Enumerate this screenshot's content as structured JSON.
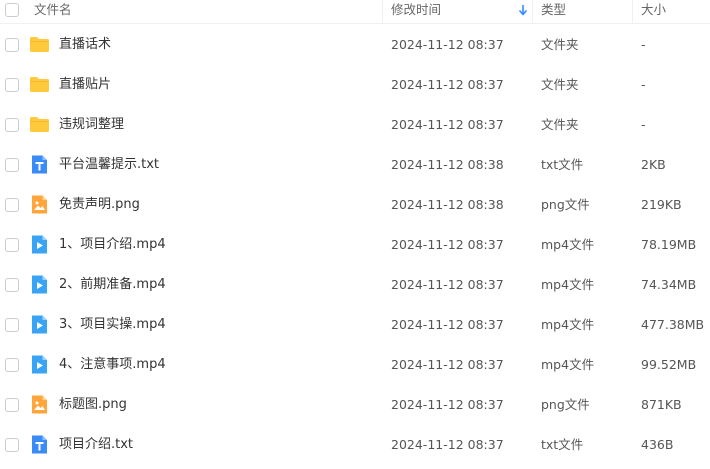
{
  "header": {
    "name_label": "文件名",
    "time_label": "修改时间",
    "type_label": "类型",
    "size_label": "大小",
    "sort_icon": "arrow-down-icon",
    "sort_color": "#2f8cff"
  },
  "colors": {
    "folder": "#ffc93c",
    "text_icon": "#3a8bf5",
    "image_icon": "#ffa53a",
    "video_icon": "#39a3f5"
  },
  "files": [
    {
      "icon": "folder-icon",
      "name": "直播话术",
      "time": "2024-11-12 08:37",
      "type": "文件夹",
      "size": "-"
    },
    {
      "icon": "folder-icon",
      "name": "直播贴片",
      "time": "2024-11-12 08:37",
      "type": "文件夹",
      "size": "-"
    },
    {
      "icon": "folder-icon",
      "name": "违规词整理",
      "time": "2024-11-12 08:37",
      "type": "文件夹",
      "size": "-"
    },
    {
      "icon": "text-file-icon",
      "name": "平台温馨提示.txt",
      "time": "2024-11-12 08:38",
      "type": "txt文件",
      "size": "2KB"
    },
    {
      "icon": "image-file-icon",
      "name": "免责声明.png",
      "time": "2024-11-12 08:38",
      "type": "png文件",
      "size": "219KB"
    },
    {
      "icon": "video-file-icon",
      "name": "1、项目介绍.mp4",
      "time": "2024-11-12 08:37",
      "type": "mp4文件",
      "size": "78.19MB"
    },
    {
      "icon": "video-file-icon",
      "name": "2、前期准备.mp4",
      "time": "2024-11-12 08:37",
      "type": "mp4文件",
      "size": "74.34MB"
    },
    {
      "icon": "video-file-icon",
      "name": "3、项目实操.mp4",
      "time": "2024-11-12 08:37",
      "type": "mp4文件",
      "size": "477.38MB"
    },
    {
      "icon": "video-file-icon",
      "name": "4、注意事项.mp4",
      "time": "2024-11-12 08:37",
      "type": "mp4文件",
      "size": "99.52MB"
    },
    {
      "icon": "image-file-icon",
      "name": "标题图.png",
      "time": "2024-11-12 08:37",
      "type": "png文件",
      "size": "871KB"
    },
    {
      "icon": "text-file-icon",
      "name": "项目介绍.txt",
      "time": "2024-11-12 08:37",
      "type": "txt文件",
      "size": "436B"
    }
  ]
}
